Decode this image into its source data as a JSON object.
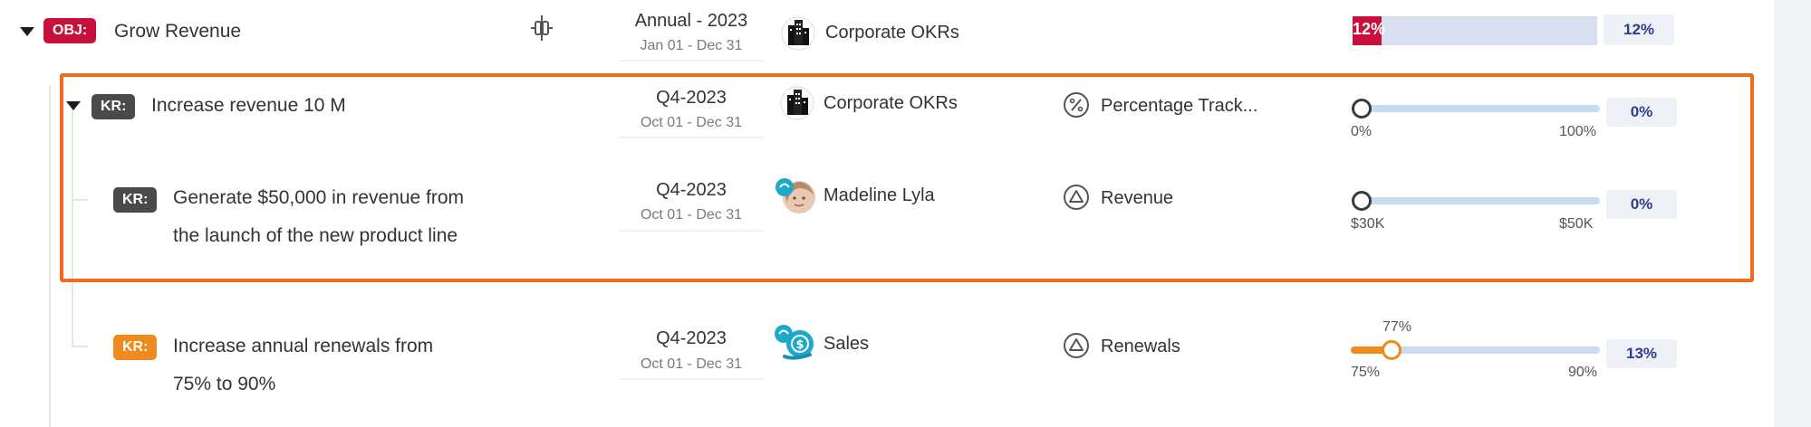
{
  "objective": {
    "badge": "OBJ:",
    "title": "Grow Revenue",
    "period": "Annual - 2023",
    "date_range": "Jan 01 - Dec 31",
    "owner": "Corporate OKRs",
    "progress_label": "12%",
    "progress_pct": "12%",
    "progress_value": 0.12,
    "colors": {
      "badge": "#c8113a",
      "bar": "#d8dff0"
    }
  },
  "key_results": [
    {
      "badge": "KR:",
      "title": "Increase revenue 10 M",
      "period": "Q4-2023",
      "date_range": "Oct 01 - Dec 31",
      "owner": "Corporate OKRs",
      "metric": "Percentage Track...",
      "metric_icon": "percent-icon",
      "scale_start": "0%",
      "scale_end": "100%",
      "progress_pct": "0%",
      "progress_value": 0
    },
    {
      "badge": "KR:",
      "title_line1": "Generate $50,000 in revenue from",
      "title_line2": "the launch of the new product line",
      "period": "Q4-2023",
      "date_range": "Oct 01 - Dec 31",
      "owner": "Madeline Lyla",
      "metric": "Revenue",
      "metric_icon": "triangle-icon",
      "scale_start": "$30K",
      "scale_end": "$50K",
      "progress_pct": "0%",
      "progress_value": 0
    },
    {
      "badge": "KR:",
      "title_line1": "Increase annual renewals from",
      "title_line2": "75% to 90%",
      "period": "Q4-2023",
      "date_range": "Oct 01 - Dec 31",
      "owner": "Sales",
      "metric": "Renewals",
      "metric_icon": "triangle-icon",
      "current_value": "77%",
      "scale_start": "75%",
      "scale_end": "90%",
      "progress_pct": "13%",
      "progress_value": 0.13,
      "colors": {
        "badge": "#ef8a1d",
        "progress": "#ef8a1d"
      }
    }
  ]
}
